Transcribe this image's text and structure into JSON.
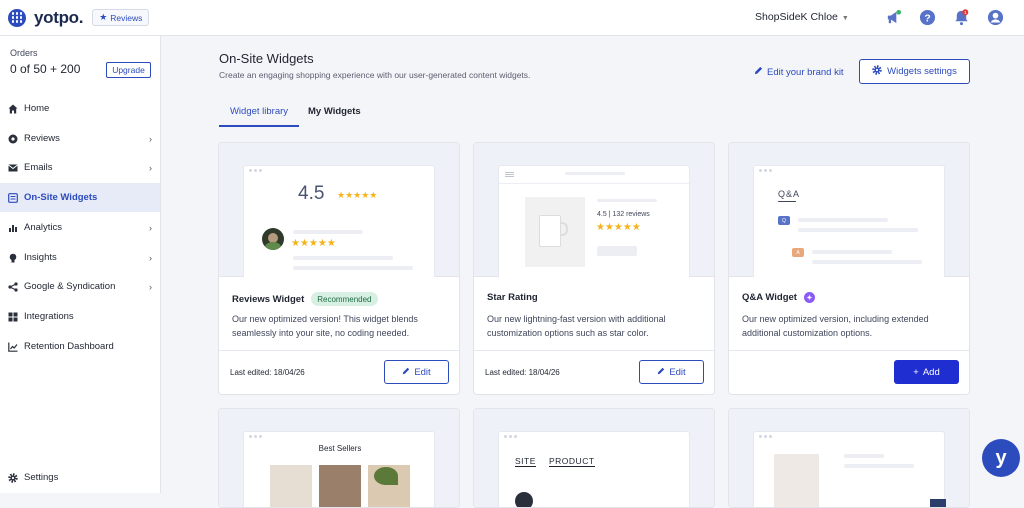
{
  "topbar": {
    "logo": "yotpo.",
    "product_badge": "Reviews",
    "store_name": "ShopSideK Chloe",
    "notification_count": "1",
    "icons": [
      "apps-grid-icon",
      "megaphone-icon",
      "help-icon",
      "bell-icon",
      "user-icon"
    ]
  },
  "sidebar": {
    "orders_label": "Orders",
    "orders_value": "0 of 50 + 200",
    "upgrade_label": "Upgrade",
    "items": [
      {
        "label": "Home",
        "icon": "home-icon",
        "has_arrow": false
      },
      {
        "label": "Reviews",
        "icon": "reviews-icon",
        "has_arrow": true
      },
      {
        "label": "Emails",
        "icon": "email-icon",
        "has_arrow": true
      },
      {
        "label": "On-Site Widgets",
        "icon": "widgets-icon",
        "has_arrow": false,
        "active": true
      },
      {
        "label": "Analytics",
        "icon": "analytics-icon",
        "has_arrow": true
      },
      {
        "label": "Insights",
        "icon": "lightbulb-icon",
        "has_arrow": true
      },
      {
        "label": "Google & Syndication",
        "icon": "share-icon",
        "has_arrow": true
      },
      {
        "label": "Integrations",
        "icon": "integrations-icon",
        "has_arrow": false
      },
      {
        "label": "Retention Dashboard",
        "icon": "chart-line-icon",
        "has_arrow": false
      }
    ],
    "settings_label": "Settings"
  },
  "main": {
    "title": "On-Site Widgets",
    "subtitle": "Create an engaging shopping experience with our user-generated content widgets.",
    "brand_link": "Edit your brand kit",
    "settings_button": "Widgets settings",
    "tabs": [
      {
        "label": "Widget library",
        "active": true
      },
      {
        "label": "My Widgets",
        "active": false
      }
    ],
    "cards": [
      {
        "title": "Reviews Widget",
        "badge": "Recommended",
        "description": "Our new optimized version! This widget blends seamlessly into your site, no coding needed.",
        "last_edited": "Last edited: 18/04/26",
        "button": "Edit",
        "preview_rating": "4.5"
      },
      {
        "title": "Star Rating",
        "badge": "",
        "description": "Our new lightning-fast version with additional customization options such as star color.",
        "last_edited": "Last edited: 18/04/26",
        "button": "Edit",
        "preview_rating": "4.5 | 132 reviews"
      },
      {
        "title": "Q&A Widget",
        "badge": "",
        "description": "Our new optimized version, including extended additional customization options.",
        "last_edited": "",
        "button": "Add",
        "preview_heading": "Q&A",
        "preview_q": "Q",
        "preview_a": "A"
      }
    ],
    "row2_previews": {
      "best_sellers": "Best Sellers",
      "site": "SITE",
      "product": "PRODUCT"
    }
  },
  "chat_button": "y",
  "colors": {
    "accent": "#2c4bbd",
    "add_button": "#1f2ed1",
    "star": "#f5b31b",
    "recommended_bg": "#d8f0e3"
  }
}
